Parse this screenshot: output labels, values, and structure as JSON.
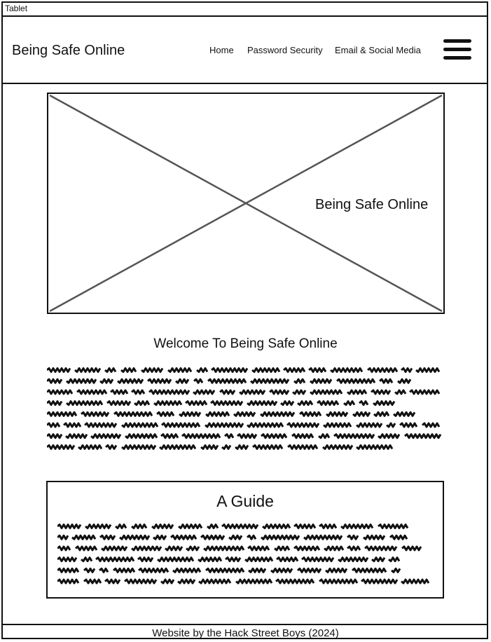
{
  "window": {
    "tab_label": "Tablet"
  },
  "header": {
    "brand": "Being Safe Online",
    "nav": [
      "Home",
      "Password Security",
      "Email & Social Media"
    ]
  },
  "hero": {
    "title": "Being Safe Online"
  },
  "welcome": {
    "heading": "Welcome To Being Safe Online"
  },
  "guide": {
    "heading": "A Guide"
  },
  "footer": {
    "text": "Website by the Hack Street Boys (2024)"
  }
}
